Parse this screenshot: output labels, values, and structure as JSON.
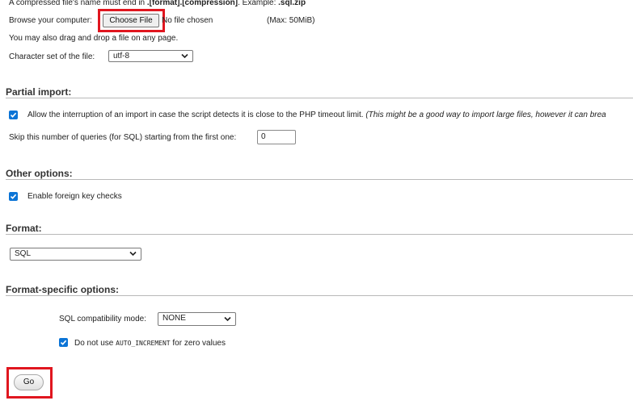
{
  "file_upload": {
    "note_prefix": "A compressed file's name must end in ",
    "note_format": ".[format].[compression]",
    "note_mid": ". Example: ",
    "note_example": ".sql.zip",
    "browse_label": "Browse your computer:",
    "choose_file_label": "Choose File",
    "no_file_text": "No file chosen",
    "max_size": "(Max: 50MiB)",
    "drag_drop_note": "You may also drag and drop a file on any page.",
    "charset_label": "Character set of the file:",
    "charset_value": "utf-8"
  },
  "partial_import": {
    "title": "Partial import:",
    "allow_interrupt_label": "Allow the interruption of an import in case the script detects it is close to the PHP timeout limit.",
    "allow_interrupt_hint": "(This might be a good way to import large files, however it can brea",
    "allow_interrupt_checked": true,
    "skip_label": "Skip this number of queries (for SQL) starting from the first one:",
    "skip_value": "0"
  },
  "other_options": {
    "title": "Other options:",
    "foreign_key_label": "Enable foreign key checks",
    "foreign_key_checked": true
  },
  "format": {
    "title": "Format:",
    "selected": "SQL"
  },
  "format_specific": {
    "title": "Format-specific options:",
    "compat_label": "SQL compatibility mode:",
    "compat_value": "NONE",
    "auto_inc_prefix": "Do not use ",
    "auto_inc_code": "AUTO_INCREMENT",
    "auto_inc_suffix": " for zero values",
    "auto_inc_checked": true
  },
  "submit": {
    "go_label": "Go"
  },
  "colors": {
    "highlight": "#e0161f",
    "checkbox": "#0b74d6"
  }
}
